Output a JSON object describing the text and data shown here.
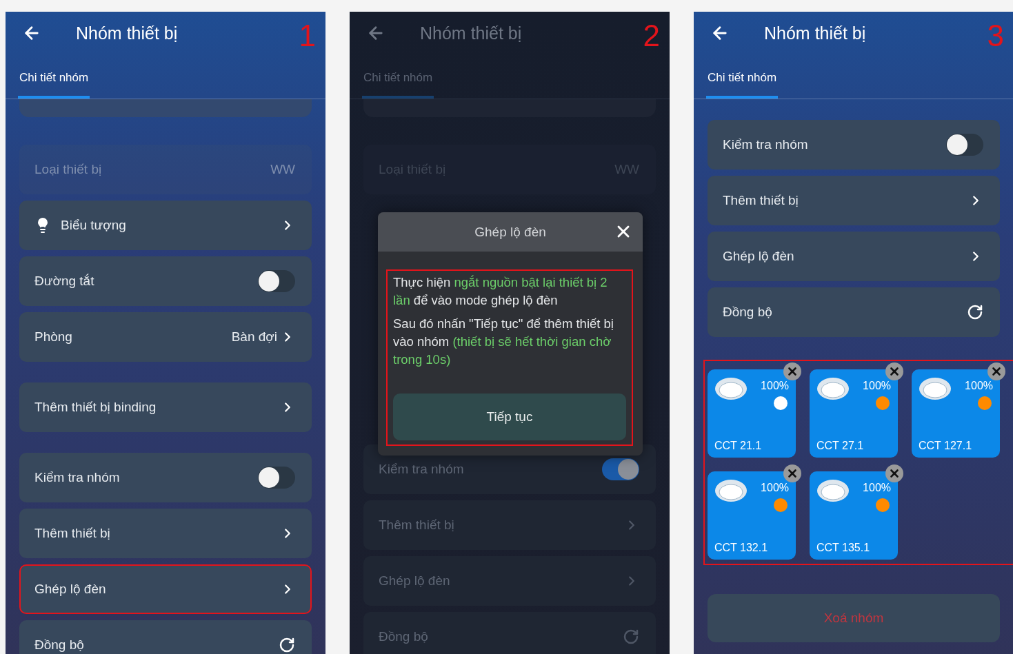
{
  "screens": [
    {
      "number": "1",
      "title": "Nhóm thiết bị",
      "dimmed": false,
      "tabs": [
        {
          "label": "Chi tiết nhóm",
          "selected": true
        }
      ],
      "clipped_card_above": true,
      "blocks": [
        {
          "kind": "section",
          "rows": [
            {
              "kind": "info",
              "label": "Loại thiết bị",
              "value": "WW",
              "disabled": true,
              "highlighted": false
            },
            {
              "kind": "icon_nav",
              "label": "Biểu tượng",
              "disabled": false,
              "highlighted": false
            },
            {
              "kind": "toggle",
              "label": "Đường tắt",
              "on": false,
              "disabled": false,
              "highlighted": false
            },
            {
              "kind": "nav",
              "label": "Phòng",
              "value": "Bàn đợi",
              "disabled": false,
              "highlighted": false
            }
          ]
        },
        {
          "kind": "section",
          "rows": [
            {
              "kind": "nav",
              "label": "Thêm thiết bị binding",
              "disabled": false,
              "highlighted": false
            }
          ]
        },
        {
          "kind": "section",
          "rows": [
            {
              "kind": "toggle",
              "label": "Kiểm tra nhóm",
              "on": false,
              "disabled": false,
              "highlighted": false
            },
            {
              "kind": "nav",
              "label": "Thêm thiết bị",
              "disabled": false,
              "highlighted": false
            },
            {
              "kind": "nav",
              "label": "Ghép lộ đèn",
              "disabled": false,
              "highlighted": true
            },
            {
              "kind": "sync",
              "label": "Đồng bộ",
              "disabled": false,
              "highlighted": false
            }
          ]
        }
      ]
    },
    {
      "number": "2",
      "title": "Nhóm thiết bị",
      "dimmed": true,
      "tabs": [
        {
          "label": "Chi tiết nhóm",
          "selected": true
        }
      ],
      "clipped_card_above": true,
      "blocks": [
        {
          "kind": "section",
          "rows": [
            {
              "kind": "info",
              "label": "Loại thiết bị",
              "value": "WW",
              "disabled": true,
              "highlighted": false
            }
          ]
        },
        {
          "kind": "dialog",
          "title": "Ghép lộ đèn",
          "annotated": true,
          "button": "Tiếp tục",
          "paragraphs": [
            [
              {
                "text": "Thực hiện ",
                "accent": false
              },
              {
                "text": "ngắt nguồn bật lại thiết bị 2 lần",
                "accent": true
              },
              {
                "text": " để vào mode ghép lộ đèn",
                "accent": false
              }
            ],
            [
              {
                "text": "Sau đó nhấn \"Tiếp tục\" để thêm thiết bị vào nhóm ",
                "accent": false
              },
              {
                "text": "(thiết bị sẽ hết thời gian chờ trong 10s)",
                "accent": true
              }
            ]
          ]
        },
        {
          "kind": "section",
          "rows": [
            {
              "kind": "toggle",
              "label": "Kiểm tra nhóm",
              "on": true,
              "disabled": false,
              "highlighted": false
            },
            {
              "kind": "nav",
              "label": "Thêm thiết bị",
              "disabled": false,
              "highlighted": false
            },
            {
              "kind": "nav",
              "label": "Ghép lộ đèn",
              "disabled": false,
              "highlighted": false
            },
            {
              "kind": "sync",
              "label": "Đồng bộ",
              "disabled": false,
              "highlighted": false
            }
          ]
        }
      ]
    },
    {
      "number": "3",
      "title": "Nhóm thiết bị",
      "dimmed": false,
      "tabs": [
        {
          "label": "Chi tiết nhóm",
          "selected": true
        }
      ],
      "clipped_card_above": false,
      "blocks": [
        {
          "kind": "section",
          "rows": [
            {
              "kind": "toggle",
              "label": "Kiểm tra nhóm",
              "on": false,
              "disabled": false,
              "highlighted": false
            },
            {
              "kind": "nav",
              "label": "Thêm thiết bị",
              "disabled": false,
              "highlighted": false
            },
            {
              "kind": "nav",
              "label": "Ghép lộ đèn",
              "disabled": false,
              "highlighted": false
            },
            {
              "kind": "sync",
              "label": "Đồng bộ",
              "disabled": false,
              "highlighted": false
            }
          ]
        },
        {
          "kind": "devices",
          "annotated": true,
          "items": [
            {
              "name": "CCT 21.1",
              "brightness": "100%",
              "color": "#ffffff"
            },
            {
              "name": "CCT 27.1",
              "brightness": "100%",
              "color": "#ff8a00"
            },
            {
              "name": "CCT 127.1",
              "brightness": "100%",
              "color": "#ff8a00"
            },
            {
              "name": "CCT 132.1",
              "brightness": "100%",
              "color": "#ff8a00"
            },
            {
              "name": "CCT 135.1",
              "brightness": "100%",
              "color": "#ff8a00"
            }
          ]
        },
        {
          "kind": "danger_button",
          "label": "Xoá nhóm"
        }
      ]
    }
  ]
}
